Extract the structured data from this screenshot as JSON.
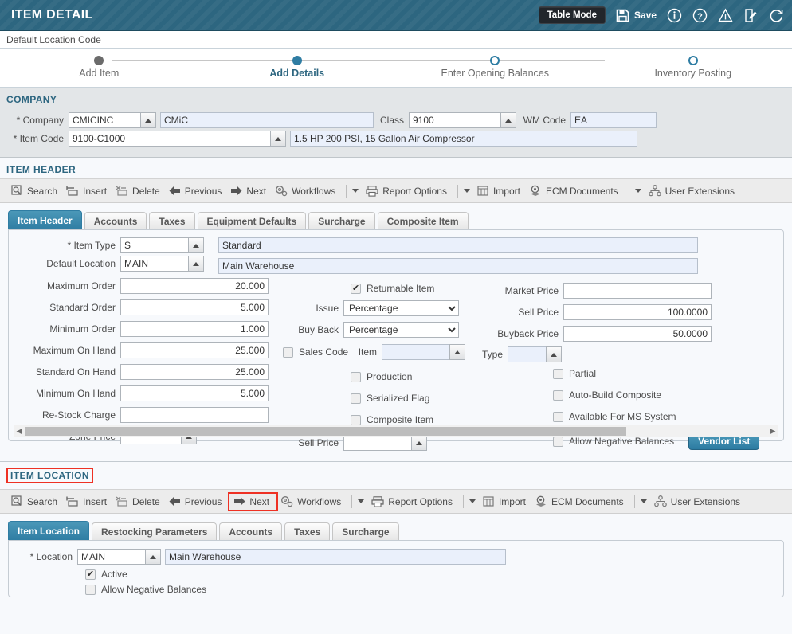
{
  "titlebar": {
    "title": "ITEM DETAIL",
    "table_mode_label": "Table Mode",
    "save_label": "Save",
    "icons": [
      "save-icon",
      "info-icon",
      "help-icon",
      "warning-icon",
      "notes-icon",
      "refresh-icon"
    ],
    "bg_color": "#2d6680"
  },
  "breadcrumb": {
    "text": "Default Location Code"
  },
  "wizard": {
    "steps": [
      {
        "label": "Add Item",
        "state": "done"
      },
      {
        "label": "Add Details",
        "state": "current"
      },
      {
        "label": "Enter Opening Balances",
        "state": "todo"
      },
      {
        "label": "Inventory Posting",
        "state": "todo"
      }
    ],
    "accent_color": "#2f7da3"
  },
  "company": {
    "section_title": "COMPANY",
    "fields": {
      "company_label": "* Company",
      "company_code": "CMICINC",
      "company_name": "CMiC",
      "class_label": "Class",
      "class_value": "9100",
      "wm_code_label": "WM Code",
      "wm_code_value": "EA",
      "item_code_label": "* Item Code",
      "item_code_value": "9100-C1000",
      "item_desc_value": "1.5 HP 200 PSI, 15 Gallon Air Compressor"
    }
  },
  "item_header": {
    "section_title": "ITEM HEADER",
    "toolbar": [
      {
        "label": "Search",
        "icon": "search-icon"
      },
      {
        "label": "Insert",
        "icon": "insert-icon"
      },
      {
        "label": "Delete",
        "icon": "delete-icon"
      },
      {
        "label": "Previous",
        "icon": "arrow-left-icon"
      },
      {
        "label": "Next",
        "icon": "arrow-right-icon"
      },
      {
        "label": "Workflows",
        "icon": "workflows-icon"
      },
      {
        "label": "Report Options",
        "icon": "print-icon"
      },
      {
        "label": "Import",
        "icon": "import-icon"
      },
      {
        "label": "ECM Documents",
        "icon": "ecm-icon"
      },
      {
        "label": "User Extensions",
        "icon": "user-extensions-icon"
      }
    ],
    "tabs": [
      {
        "label": "Item Header",
        "active": true
      },
      {
        "label": "Accounts",
        "active": false
      },
      {
        "label": "Taxes",
        "active": false
      },
      {
        "label": "Equipment Defaults",
        "active": false
      },
      {
        "label": "Surcharge",
        "active": false
      },
      {
        "label": "Composite Item",
        "active": false
      }
    ],
    "left_fields": [
      {
        "label": "* Item Type",
        "value": "S",
        "desc": "Standard",
        "type": "lov"
      },
      {
        "label": "Default Location",
        "value": "MAIN",
        "desc": "Main Warehouse",
        "type": "lov"
      },
      {
        "label": "Maximum Order",
        "value": "20.000",
        "type": "num"
      },
      {
        "label": "Standard Order",
        "value": "5.000",
        "type": "num"
      },
      {
        "label": "Minimum Order",
        "value": "1.000",
        "type": "num"
      },
      {
        "label": "Maximum On Hand",
        "value": "25.000",
        "type": "num"
      },
      {
        "label": "Standard On Hand",
        "value": "25.000",
        "type": "num"
      },
      {
        "label": "Minimum On Hand",
        "value": "5.000",
        "type": "num"
      },
      {
        "label": "Re-Stock Charge",
        "value": "",
        "type": "num"
      },
      {
        "label": "Zone Price",
        "value": "",
        "type": "lov-empty"
      }
    ],
    "mid": {
      "returnable_label": "Returnable Item",
      "returnable_checked": true,
      "issue_label": "Issue",
      "issue_value": "Percentage",
      "issue_options": [
        "Percentage"
      ],
      "buyback_label": "Buy Back",
      "buyback_value": "Percentage",
      "buyback_options": [
        "Percentage"
      ],
      "sales_code_label": "Sales Code",
      "sales_code_checked": false,
      "item_label": "Item",
      "item_value": "",
      "type_label": "Type",
      "type_value": "",
      "production_label": "Production",
      "production_checked": false,
      "serialized_label": "Serialized Flag",
      "serialized_checked": false,
      "composite_label": "Composite Item",
      "composite_checked": false,
      "sell_price_label": "Sell Price",
      "sell_price_value": ""
    },
    "right": {
      "market_price_label": "Market Price",
      "market_price_value": "",
      "sell_price_label": "Sell Price",
      "sell_price_value": "100.0000",
      "buyback_price_label": "Buyback Price",
      "buyback_price_value": "50.0000",
      "partial_label": "Partial",
      "partial_checked": false,
      "autobuild_label": "Auto-Build Composite",
      "autobuild_checked": false,
      "ms_system_label": "Available For MS System",
      "ms_system_checked": false,
      "allow_neg_label": "Allow Negative Balances",
      "allow_neg_checked": false,
      "vendor_list_label": "Vendor List"
    }
  },
  "item_location": {
    "section_title": "ITEM LOCATION",
    "section_title_highlighted": true,
    "highlight_color": "#ee3124",
    "toolbar": [
      {
        "label": "Search",
        "icon": "search-icon",
        "highlighted": false
      },
      {
        "label": "Insert",
        "icon": "insert-icon",
        "highlighted": false
      },
      {
        "label": "Delete",
        "icon": "delete-icon",
        "highlighted": false
      },
      {
        "label": "Previous",
        "icon": "arrow-left-icon",
        "highlighted": false
      },
      {
        "label": "Next",
        "icon": "arrow-right-icon",
        "highlighted": true
      },
      {
        "label": "Workflows",
        "icon": "workflows-icon",
        "highlighted": false
      },
      {
        "label": "Report Options",
        "icon": "print-icon",
        "highlighted": false
      },
      {
        "label": "Import",
        "icon": "import-icon",
        "highlighted": false
      },
      {
        "label": "ECM Documents",
        "icon": "ecm-icon",
        "highlighted": false
      },
      {
        "label": "User Extensions",
        "icon": "user-extensions-icon",
        "highlighted": false
      }
    ],
    "tabs": [
      {
        "label": "Item Location",
        "active": true
      },
      {
        "label": "Restocking Parameters",
        "active": false
      },
      {
        "label": "Accounts",
        "active": false
      },
      {
        "label": "Taxes",
        "active": false
      },
      {
        "label": "Surcharge",
        "active": false
      }
    ],
    "fields": {
      "location_label": "* Location",
      "location_value": "MAIN",
      "location_desc": "Main Warehouse",
      "active_label": "Active",
      "active_checked": true,
      "allow_neg_label": "Allow Negative Balances",
      "allow_neg_checked": false
    }
  }
}
